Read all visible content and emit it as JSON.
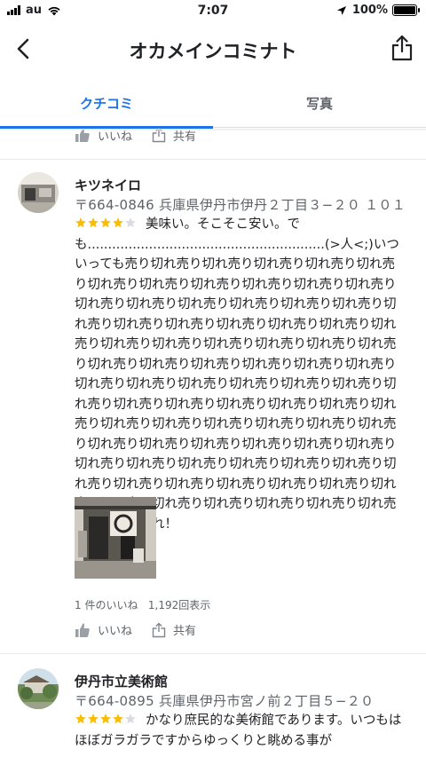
{
  "status_bar": {
    "carrier": "au",
    "time": "7:07",
    "battery": "100%"
  },
  "header": {
    "title": "オカメインコミナト"
  },
  "tabs": [
    {
      "label": "クチコミ",
      "active": true
    },
    {
      "label": "写真",
      "active": false
    }
  ],
  "actions": {
    "like": "いいね",
    "share": "共有"
  },
  "reviews": [
    {
      "name": "キツネイロ",
      "address": "〒664-0846 兵庫県伊丹市伊丹２丁目３−２０ １０１",
      "rating": 4,
      "text": "美味い。そこそこ安い。でも..........................................................(>人<;)いついっても売り切れ売り切れ売り切れ売り切れ売り切れ売り切れ売り切れ売り切れ売り切れ売り切れ売り切れ売り切れ売り切れ売り切れ売り切れ売り切れ売り切れ売り切れ売り切れ売り切れ売り切れ売り切れ売り切れ売り切れ売り切れ売り切れ売り切れ売り切れ売り切れ売り切れ売り切れ売り切れ売り切れ売り切れ売り切れ売り切れ売り切れ売り切れ売り切れ売り切れ売り切れ売り切れ売り切れ売り切れ売り切れ売り切れ売り切れ売り切れ売り切れ売り切れ売り切れ売り切れ売り切れ売り切れ売り切れ売り切れ売り切れ売り切れ売り切れ売り切れ売り切れ売り切れ売り切れ売り切れ売り切れ売り切れ売り切れ売り切れ売り切れ売り切れ売り切れ売り切れ売り切れ売り切れ売り切れ売り切れ売り切れ売り切れ売り切れ売り切れ売り切れ売り切れ！",
      "likes": "1 件のいいね",
      "views": "1,192回表示"
    },
    {
      "name": "伊丹市立美術館",
      "address": "〒664-0895 兵庫県伊丹市宮ノ前２丁目５−２０",
      "rating": 4,
      "text": "かなり庶民的な美術館であります。いつもはほぼガラガラですからゆっくりと眺める事が"
    }
  ],
  "colors": {
    "accent": "#1a73e8",
    "star": "#fbbc04",
    "star_empty": "#dadce0",
    "secondary_text": "#5f6368"
  },
  "icons": [
    "back-arrow-icon",
    "share-icon",
    "thumbs-up-icon",
    "share-small-icon",
    "star-icon",
    "wifi-icon",
    "location-arrow-icon",
    "battery-icon",
    "signal-icon"
  ]
}
